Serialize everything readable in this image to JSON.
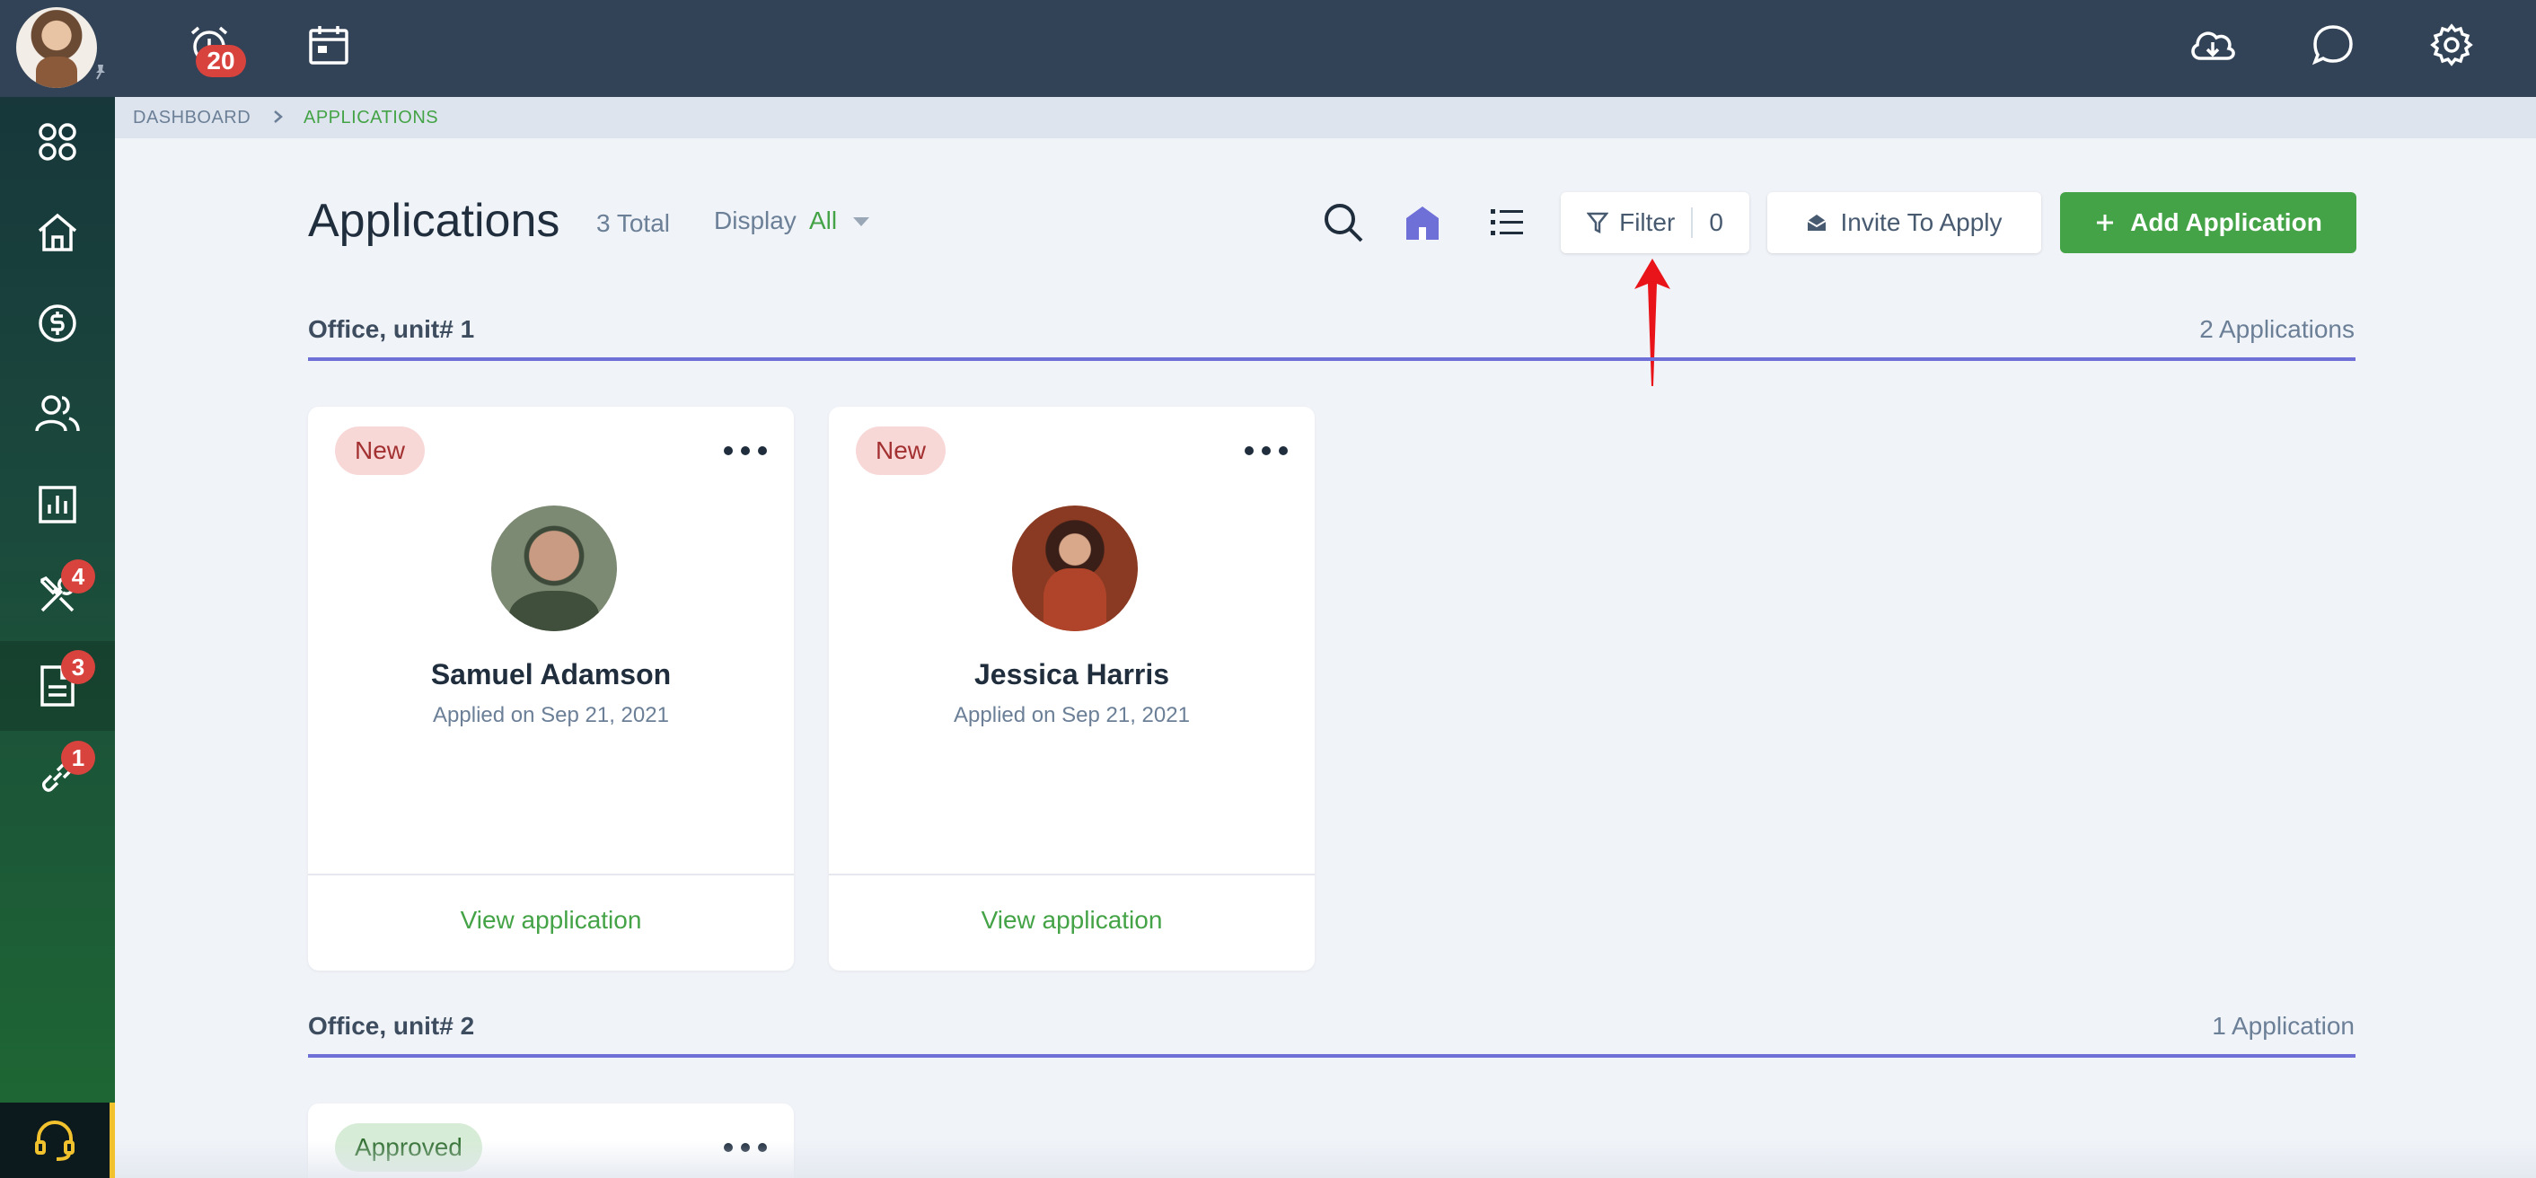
{
  "topbar": {
    "reminder_badge": "20"
  },
  "sidebar": {
    "items": [
      {
        "name": "apps",
        "badge": ""
      },
      {
        "name": "home",
        "badge": ""
      },
      {
        "name": "payments",
        "badge": ""
      },
      {
        "name": "people",
        "badge": ""
      },
      {
        "name": "reports",
        "badge": ""
      },
      {
        "name": "maintenance",
        "badge": "4"
      },
      {
        "name": "applications",
        "badge": "3"
      },
      {
        "name": "links",
        "badge": "1"
      }
    ]
  },
  "breadcrumb": {
    "root": "DASHBOARD",
    "current": "APPLICATIONS"
  },
  "header": {
    "title": "Applications",
    "total": "3 Total",
    "display_label": "Display",
    "display_value": "All"
  },
  "toolbar": {
    "filter_label": "Filter",
    "filter_count": "0",
    "invite_label": "Invite To Apply",
    "add_label": "Add Application"
  },
  "sections": [
    {
      "title": "Office, unit# 1",
      "count": "2 Applications",
      "cards": [
        {
          "status": "New",
          "name": "Samuel Adamson",
          "applied": "Applied on Sep 21, 2021",
          "link": "View application"
        },
        {
          "status": "New",
          "name": "Jessica Harris",
          "applied": "Applied on Sep 21, 2021",
          "link": "View application"
        }
      ]
    },
    {
      "title": "Office, unit# 2",
      "count": "1 Application",
      "cards": [
        {
          "status": "Approved"
        }
      ]
    }
  ],
  "colors": {
    "topbar": "#334357",
    "accent_green": "#45a347",
    "section_line": "#6f6fd8",
    "badge_red": "#d9433e",
    "arrow_red": "#e8141a"
  }
}
